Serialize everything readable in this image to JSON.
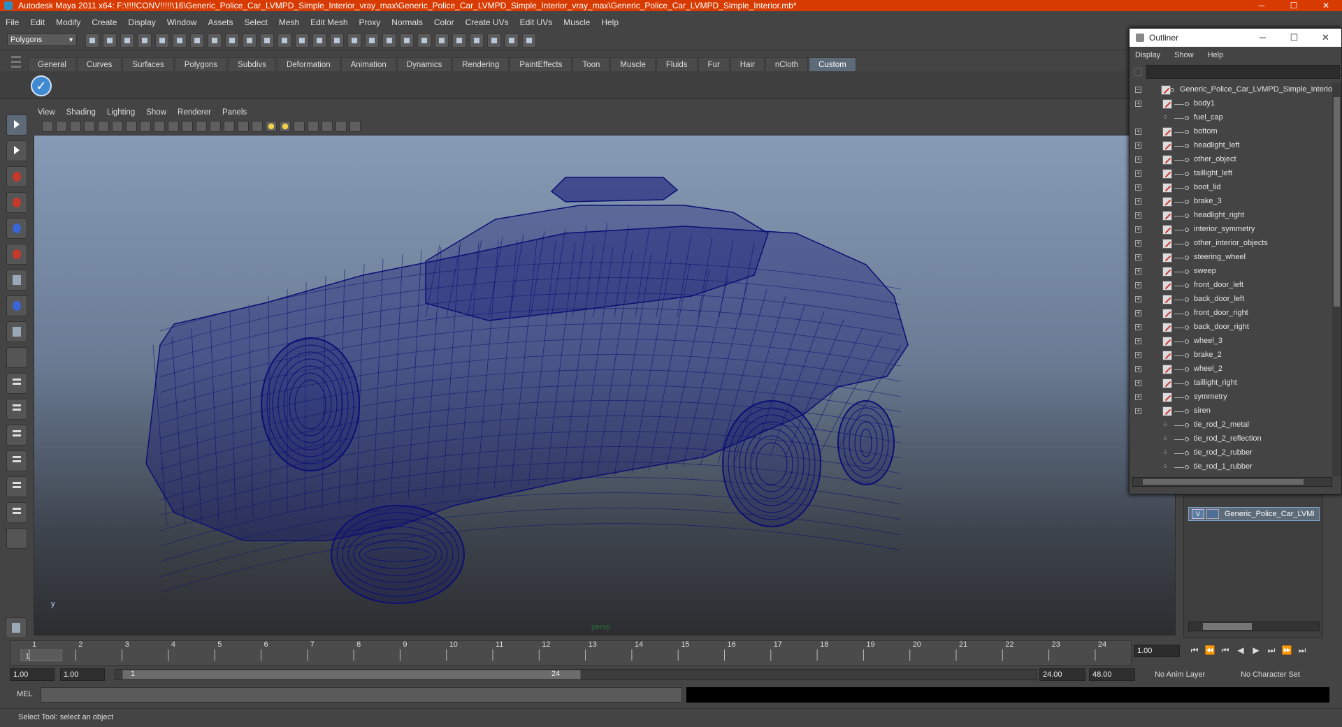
{
  "window": {
    "title": "Autodesk Maya 2011 x64: F:\\!!!!CONV!!!!!\\16\\Generic_Police_Car_LVMPD_Simple_Interior_vray_max\\Generic_Police_Car_LVMPD_Simple_Interior_vray_max\\Generic_Police_Car_LVMPD_Simple_Interior.mb*",
    "minimize": "─",
    "maximize": "☐",
    "close": "✕"
  },
  "menu": [
    "File",
    "Edit",
    "Modify",
    "Create",
    "Display",
    "Window",
    "Assets",
    "Select",
    "Mesh",
    "Edit Mesh",
    "Proxy",
    "Normals",
    "Color",
    "Create UVs",
    "Edit UVs",
    "Muscle",
    "Help"
  ],
  "toolbar": {
    "mode": "Polygons",
    "mode_arrow": "▼"
  },
  "shelf": {
    "tabs": [
      "General",
      "Curves",
      "Surfaces",
      "Polygons",
      "Subdivs",
      "Deformation",
      "Animation",
      "Dynamics",
      "Rendering",
      "PaintEffects",
      "Toon",
      "Muscle",
      "Fluids",
      "Fur",
      "Hair",
      "nCloth",
      "Custom"
    ],
    "active_tab": "Custom",
    "check_glyph": "✓"
  },
  "viewport": {
    "menu": [
      "View",
      "Shading",
      "Lighting",
      "Show",
      "Renderer",
      "Panels"
    ],
    "camera": "persp",
    "axis": "y",
    "wire_color": "#0c0f73"
  },
  "timeline": {
    "ticks": [
      "1",
      "2",
      "3",
      "4",
      "5",
      "6",
      "7",
      "8",
      "9",
      "10",
      "11",
      "12",
      "13",
      "14",
      "15",
      "16",
      "17",
      "18",
      "19",
      "20",
      "21",
      "22",
      "23",
      "24"
    ],
    "current_frame_label": "1",
    "current_frame": "1.00",
    "playback_glyphs": [
      "⏮",
      "⏪",
      "⏮",
      "◀",
      "▶",
      "⏭",
      "⏩",
      "⏭"
    ]
  },
  "range": {
    "start": "1.00",
    "start_inner": "1.00",
    "slider_start": "1",
    "slider_end": "24",
    "end_inner": "24.00",
    "end": "48.00",
    "anim_layer": "No Anim Layer",
    "char_set": "No Character Set"
  },
  "command_line": {
    "label": "MEL"
  },
  "help_line": "Select Tool: select an object",
  "layers": {
    "visible_flag": "V",
    "layer_name": "Generic_Police_Car_LVMPD_Simple_Interior"
  },
  "outliner": {
    "title": "Outliner",
    "menu": [
      "Display",
      "Show",
      "Help"
    ],
    "root": "Generic_Police_Car_LVMPD_Simple_Interior",
    "root_expander": "−",
    "expander": "+",
    "items": [
      {
        "name": "body1",
        "expand": true,
        "icon": "mesh"
      },
      {
        "name": "fuel_cap",
        "expand": false,
        "icon": "dots"
      },
      {
        "name": "bottom",
        "expand": true,
        "icon": "mesh"
      },
      {
        "name": "headlight_left",
        "expand": true,
        "icon": "mesh"
      },
      {
        "name": "other_object",
        "expand": true,
        "icon": "mesh"
      },
      {
        "name": "taillight_left",
        "expand": true,
        "icon": "mesh"
      },
      {
        "name": "boot_lid",
        "expand": true,
        "icon": "mesh"
      },
      {
        "name": "brake_3",
        "expand": true,
        "icon": "mesh"
      },
      {
        "name": "headlight_right",
        "expand": true,
        "icon": "mesh"
      },
      {
        "name": "interior_symmetry",
        "expand": true,
        "icon": "mesh"
      },
      {
        "name": "other_interior_objects",
        "expand": true,
        "icon": "mesh"
      },
      {
        "name": "steering_wheel",
        "expand": true,
        "icon": "mesh"
      },
      {
        "name": "sweep",
        "expand": true,
        "icon": "mesh"
      },
      {
        "name": "front_door_left",
        "expand": true,
        "icon": "mesh"
      },
      {
        "name": "back_door_left",
        "expand": true,
        "icon": "mesh"
      },
      {
        "name": "front_door_right",
        "expand": true,
        "icon": "mesh"
      },
      {
        "name": "back_door_right",
        "expand": true,
        "icon": "mesh"
      },
      {
        "name": "wheel_3",
        "expand": true,
        "icon": "mesh"
      },
      {
        "name": "brake_2",
        "expand": true,
        "icon": "mesh"
      },
      {
        "name": "wheel_2",
        "expand": true,
        "icon": "mesh"
      },
      {
        "name": "taillight_right",
        "expand": true,
        "icon": "mesh"
      },
      {
        "name": "symmetry",
        "expand": true,
        "icon": "mesh"
      },
      {
        "name": "siren",
        "expand": true,
        "icon": "mesh"
      },
      {
        "name": "tie_rod_2_metal",
        "expand": false,
        "icon": "dots"
      },
      {
        "name": "tie_rod_2_reflection",
        "expand": false,
        "icon": "dots"
      },
      {
        "name": "tie_rod_2_rubber",
        "expand": false,
        "icon": "dots"
      },
      {
        "name": "tie_rod_1_rubber",
        "expand": false,
        "icon": "dots"
      }
    ]
  }
}
